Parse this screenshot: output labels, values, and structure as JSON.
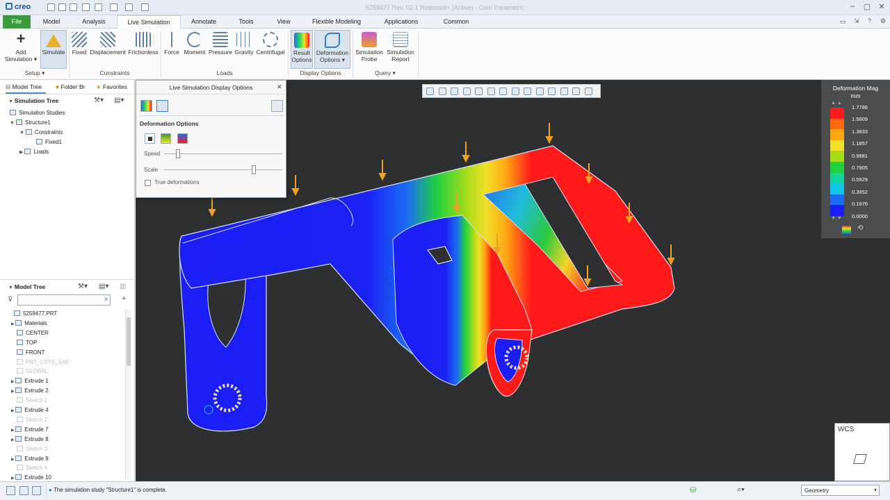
{
  "app": {
    "logo": "creo",
    "window_title": "5259477 Rev. 02-1 Released+ (Active) - Creo Parametric"
  },
  "tabs": [
    "File",
    "Model",
    "Analysis",
    "Live Simulation",
    "Annotate",
    "Tools",
    "View",
    "Flexible Modeling",
    "Applications",
    "Common"
  ],
  "ribbon": {
    "add_simulation": "Add Simulation",
    "simulate": "Simulate",
    "setup": "Setup",
    "fixed": "Fixed",
    "displacement": "Displacement",
    "frictionless": "Frictionless",
    "constraints": "Constraints",
    "force": "Force",
    "moment": "Moment",
    "pressure": "Pressure",
    "gravity": "Gravity",
    "centrifugal": "Centrifugal",
    "loads": "Loads",
    "result_options": "Result Options",
    "deformation_options": "Deformation Options",
    "display_options": "Display Options",
    "simulation_probe": "Simulation Probe",
    "simulation_report": "Simulation Report",
    "query": "Query"
  },
  "left_panel": {
    "tabs": [
      "Model Tree",
      "Folder Br",
      "Favorites"
    ],
    "sim_tree_title": "Simulation Tree",
    "sim_tree": [
      "Simulation Studies",
      "Structure1",
      "Constraints",
      "Fixed1",
      "Loads"
    ],
    "model_tree_title": "Model Tree",
    "filter_placeholder": "",
    "model_tree": [
      "5259477.PRT",
      "Materials",
      "CENTER",
      "TOP",
      "FRONT",
      "PRT_CSYS_SAE",
      "GLOBAL",
      "Extrude 1",
      "Extrude 2",
      "Sketch 1",
      "Extrude 4",
      "Sketch 2",
      "Extrude 7",
      "Extrude 8",
      "Sketch 3",
      "Extrude 9",
      "Sketch 4",
      "Extrude 10"
    ]
  },
  "dialog": {
    "title": "Live Simulation Display Options",
    "section": "Deformation Options",
    "speed": "Speed",
    "scale": "Scale",
    "true_deformations": "True deformations",
    "speed_level": 0.12,
    "scale_level": 0.76
  },
  "legend": {
    "title": "Deformation Mag",
    "unit": "mm",
    "values": [
      "1.7786",
      "1.5809",
      "1.3833",
      "1.1857",
      "0.9881",
      "0.7905",
      "0.5929",
      "0.3952",
      "0.1976",
      "0.0000"
    ],
    "colors": [
      "#ff1a1a",
      "#ff6a10",
      "#ffa515",
      "#f2e12a",
      "#a6dc19",
      "#20d23f",
      "#13d49a",
      "#15c3e6",
      "#1b6cf3",
      "#1a1ef4"
    ]
  },
  "status": {
    "message": "The simulation study \"Structure1\" is complete.",
    "filter_value": "Geometry"
  },
  "viewport": {
    "wcs_label": "WCS"
  }
}
